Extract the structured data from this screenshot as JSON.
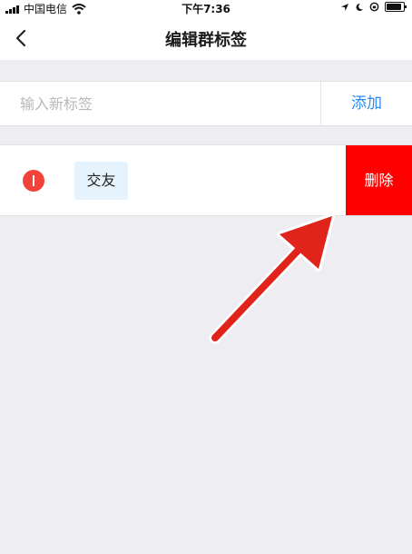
{
  "status_bar": {
    "carrier": "中国电信",
    "time": "下午7:36"
  },
  "nav": {
    "title": "编辑群标签",
    "back_icon": "chevron-left-icon"
  },
  "input_row": {
    "placeholder": "输入新标签",
    "value": "",
    "add_label": "添加"
  },
  "tags": [
    {
      "label": "交友",
      "delete_label": "删除"
    }
  ],
  "colors": {
    "accent": "#2d8cf0",
    "delete": "#ff0000",
    "remove_toggle": "#f2433b",
    "chip_bg": "#e6f3fd",
    "annotation_arrow": "#e0241b"
  }
}
